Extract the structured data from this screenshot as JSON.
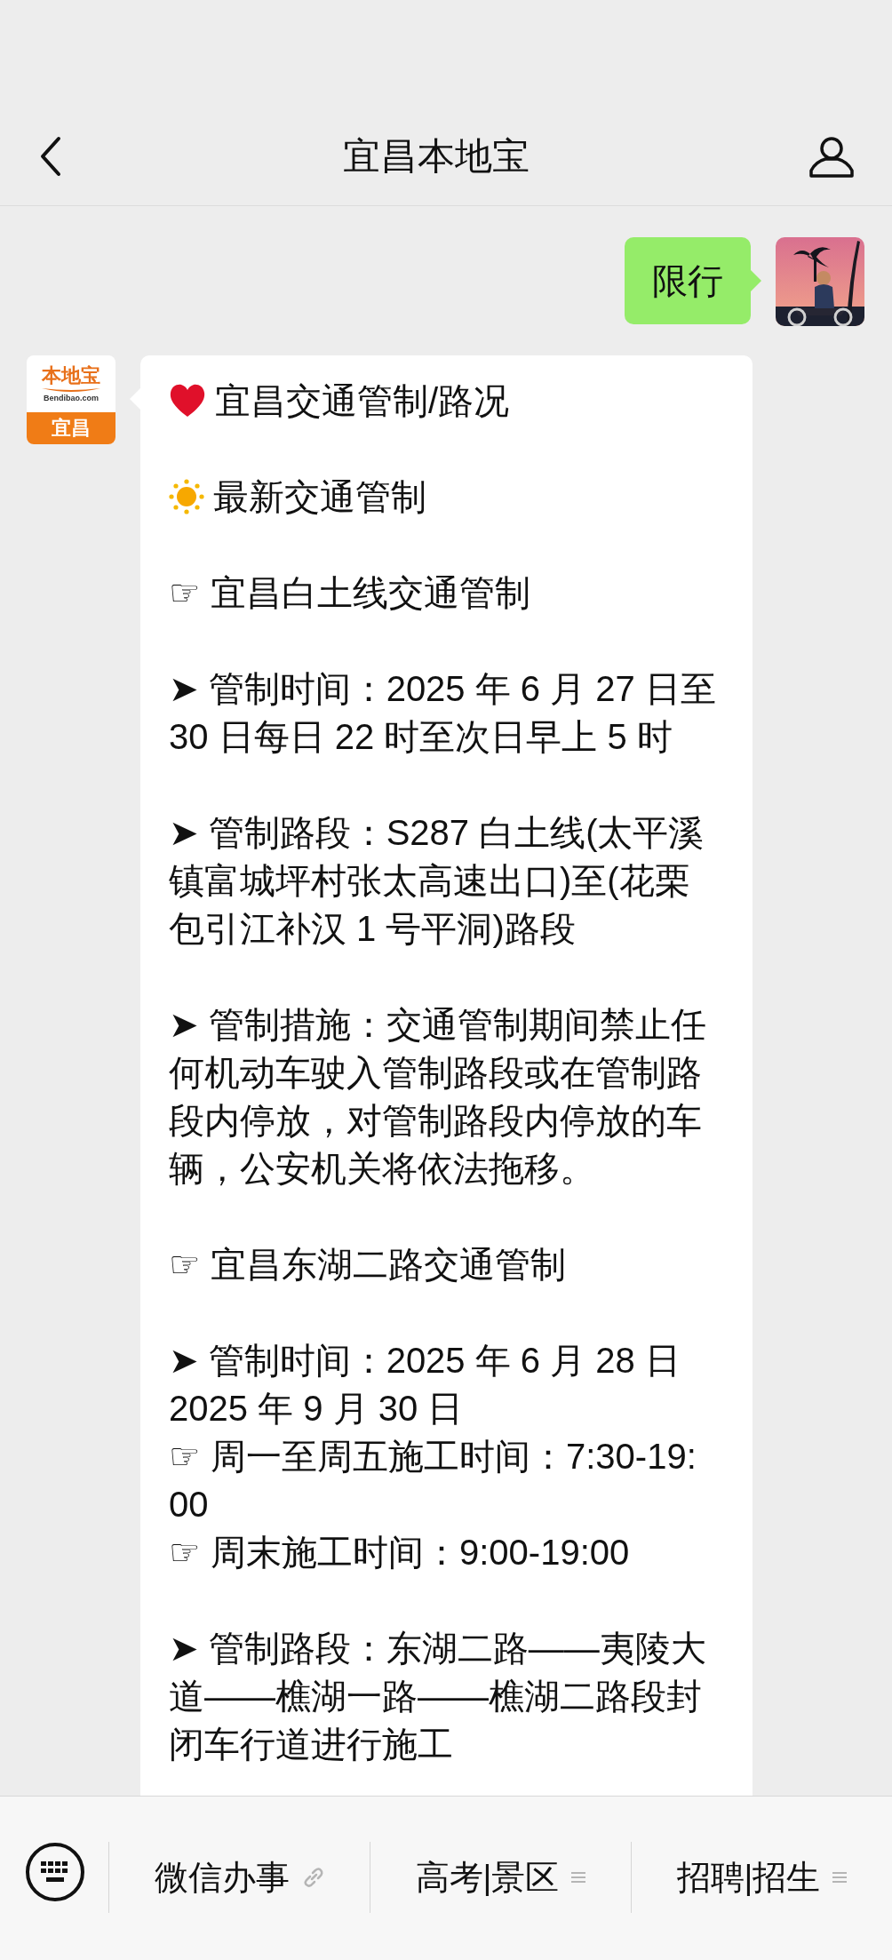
{
  "header": {
    "title": "宜昌本地宝"
  },
  "messages": [
    {
      "kind": "sent",
      "text": "限行"
    },
    {
      "kind": "received",
      "logo": {
        "brand": "本地宝",
        "site": "Bendibao.com",
        "city": "宜昌"
      },
      "paragraphs": [
        {
          "kind": "heart",
          "lines": [
            "宜昌交通管制/路况"
          ]
        },
        {
          "kind": "sun",
          "lines": [
            "最新交通管制"
          ]
        },
        {
          "lines": [
            "☞ 宜昌白土线交通管制"
          ]
        },
        {
          "lines": [
            "➤ 管制时间：2025 年 6 月 27 日至",
            "30 日每日 22 时至次日早上 5 时"
          ]
        },
        {
          "lines": [
            "➤ 管制路段：S287 白土线(太平溪",
            "镇富城坪村张太高速出口)至(花栗",
            "包引江补汉 1 号平洞)路段"
          ]
        },
        {
          "lines": [
            "➤ 管制措施：交通管制期间禁止任",
            "何机动车驶入管制路段或在管制路",
            "段内停放，对管制路段内停放的车",
            "辆，公安机关将依法拖移。"
          ]
        },
        {
          "lines": [
            "☞ 宜昌东湖二路交通管制"
          ]
        },
        {
          "lines": [
            "➤ 管制时间：2025 年 6 月 28 日",
            "2025 年 9 月 30 日",
            "☞ 周一至周五施工时间：7:30-19:",
            "00",
            "☞ 周末施工时间：9:00-19:00"
          ]
        },
        {
          "lines": [
            "➤ 管制路段：东湖二路——夷陵大",
            "道——樵湖一路——樵湖二路段封",
            "闭车行道进行施工"
          ]
        }
      ]
    }
  ],
  "bottom_menu": {
    "items": [
      {
        "label": "微信办事",
        "kind": "link"
      },
      {
        "label": "高考|景区",
        "kind": "menu"
      },
      {
        "label": "招聘|招生",
        "kind": "menu"
      }
    ]
  }
}
